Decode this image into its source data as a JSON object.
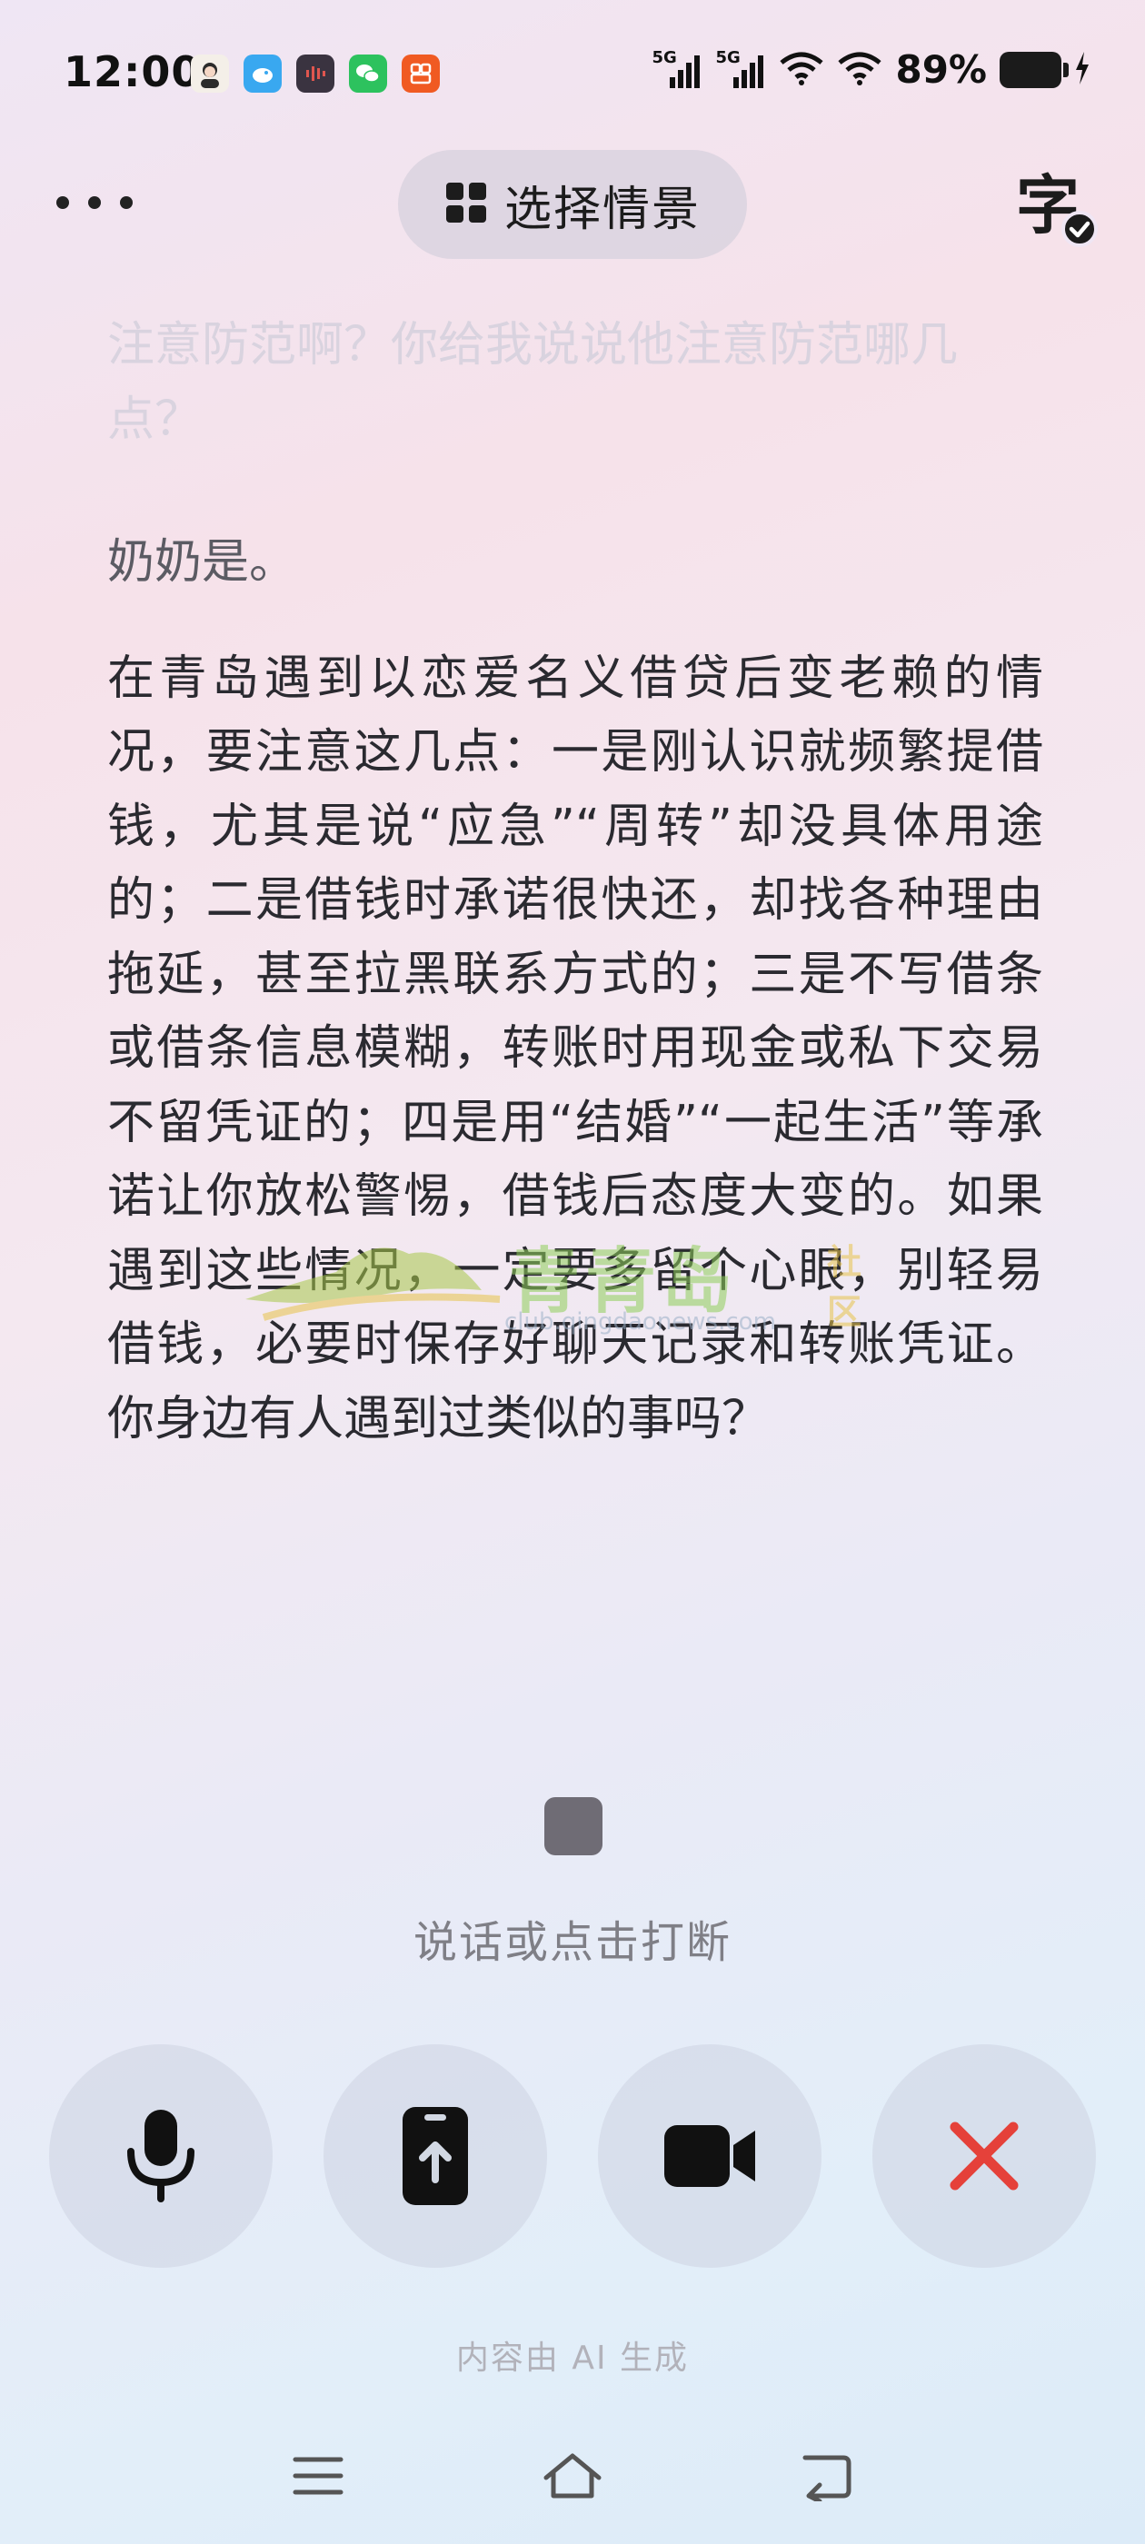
{
  "status_bar": {
    "time": "12:00",
    "battery_percent": "89%",
    "signal_1": "5G",
    "signal_2": "5G",
    "app_icons": [
      "avatar-app-icon",
      "bird-app-icon",
      "voice-recorder-icon",
      "wechat-icon",
      "taobao-icon"
    ]
  },
  "toolbar": {
    "scene_label": "选择情景",
    "subtitle_icon": "字"
  },
  "transcript": {
    "previous": "注意防范啊？你给我说说他注意防范哪几点？",
    "user": "奶奶是。",
    "assistant": "在青岛遇到以恋爱名义借贷后变老赖的情况，要注意这几点：一是刚认识就频繁提借钱，尤其是说“应急”“周转”却没具体用途的；二是借钱时承诺很快还，却找各种理由拖延，甚至拉黑联系方式的；三是不写借条或借条信息模糊，转账时用现金或私下交易不留凭证的；四是用“结婚”“一起生活”等承诺让你放松警惕，借钱后态度大变的。如果遇到这些情况，一定要多留个心眼，别轻易借钱，必要时保存好聊天记录和转账凭证。你身边有人遇到过类似的事吗？"
  },
  "watermark": {
    "text": "青青岛",
    "sub": "社区",
    "url": "club.qingdaonews.com"
  },
  "hint": "说话或点击打断",
  "controls": [
    "microphone-icon",
    "share-screen-icon",
    "video-camera-icon",
    "close-icon"
  ],
  "disclaimer": "内容由 AI 生成",
  "colors": {
    "close_red": "#e5413a",
    "control_bg": "#d2d8e3"
  }
}
